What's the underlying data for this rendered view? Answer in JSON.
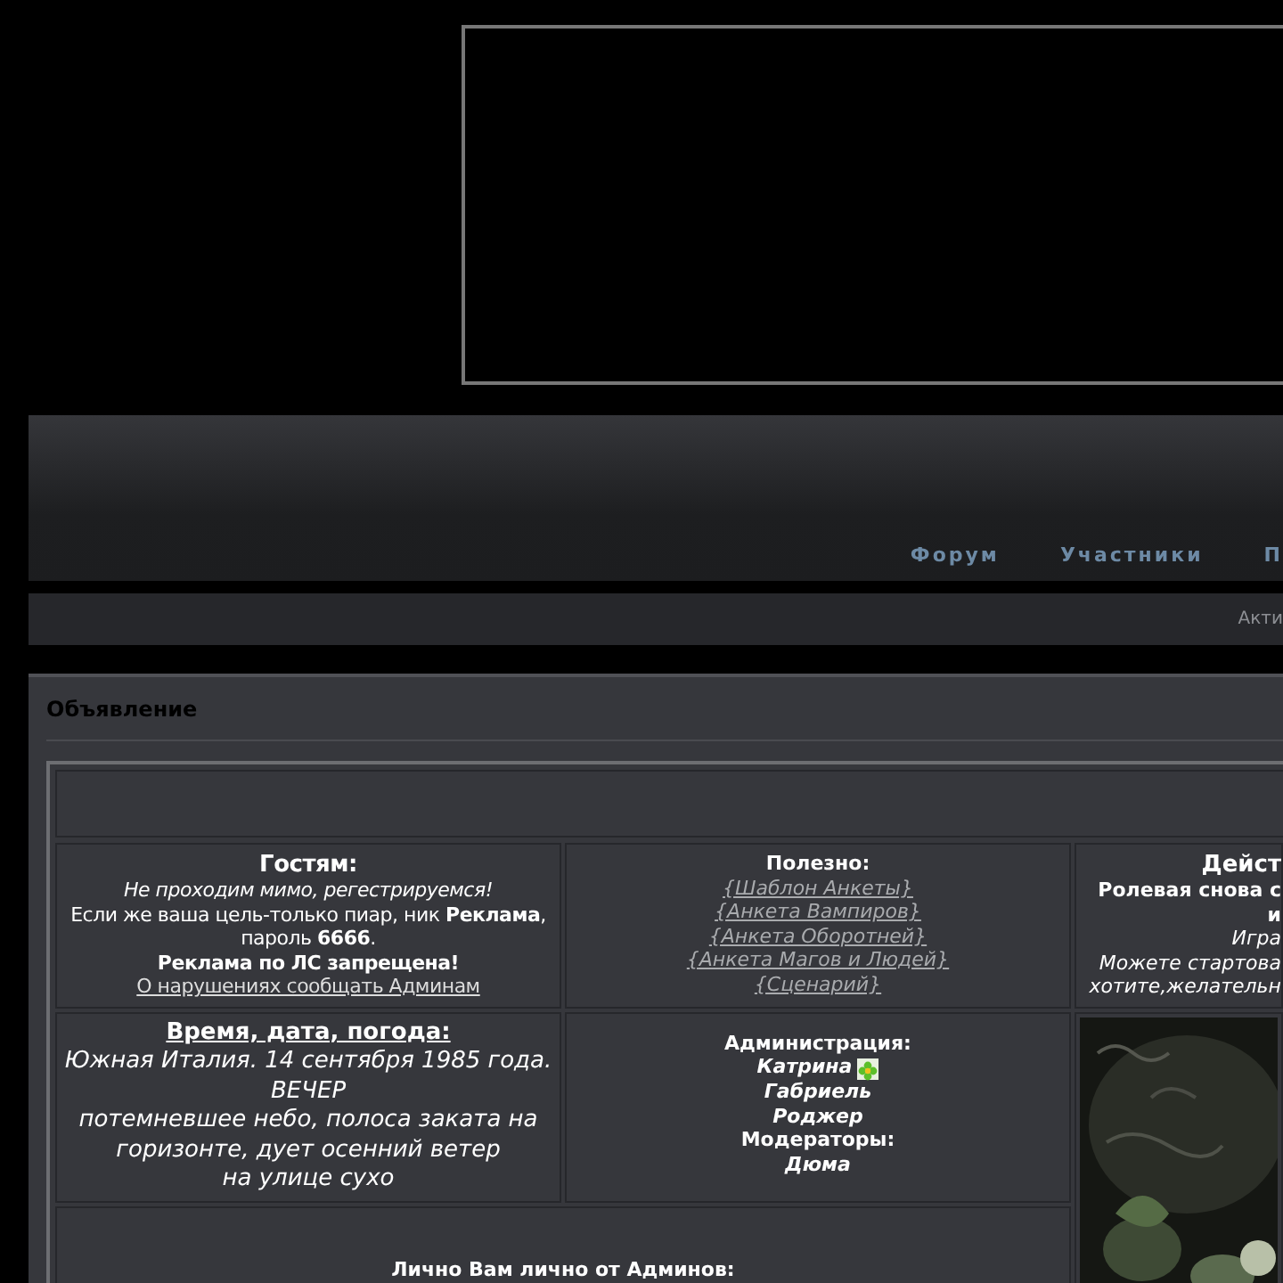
{
  "nav": [
    {
      "label": "Форум"
    },
    {
      "label": "Участники"
    },
    {
      "label": "П"
    }
  ],
  "subbar": {
    "text": "Акти"
  },
  "announcement": {
    "title": "Объявление",
    "guests": {
      "title": "Гостям:",
      "lines": [
        {
          "kind": "italic",
          "text": "Не проходим мимо, регестрируемся!"
        },
        {
          "kind": "plain",
          "text": "Если же ваша цель-только пиар, ник **Реклама**, пароль **6666**."
        },
        {
          "kind": "bold",
          "text": "Реклама по ЛС запрещена!"
        },
        {
          "kind": "link",
          "text": "О нарушениях сообщать Админам"
        }
      ]
    },
    "useful": {
      "title": "Полезно:",
      "links": [
        "{Шаблон Анкеты}",
        "{Анкета Вампиров}",
        "{Анкета Оборотней}",
        "{Анкета Магов и Людей}",
        "{Сценарий}"
      ]
    },
    "action": {
      "title": "Дейст",
      "lines": [
        {
          "kind": "bold",
          "text": "Ролевая снова с"
        },
        {
          "kind": "bold",
          "text": "и"
        },
        {
          "kind": "italic",
          "text": "Игра"
        },
        {
          "kind": "italic",
          "text": "Можете стартова"
        },
        {
          "kind": "italic",
          "text": "хотите,желательн"
        }
      ]
    },
    "time": {
      "title": "Время, дата, погода:",
      "lines": [
        "Южная Италия. 14 сентября 1985 года.",
        "ВЕЧЕР",
        "потемневшее небо, полоса заката на горизонте, дует осенний ветер",
        "на улице сухо"
      ]
    },
    "staff": [
      {
        "kind": "heading",
        "text": "Администрация:"
      },
      {
        "kind": "name",
        "text": "Катрина",
        "online_icon": true
      },
      {
        "kind": "name",
        "text": "Габриель"
      },
      {
        "kind": "name",
        "text": "Роджер"
      },
      {
        "kind": "heading",
        "text": "Модераторы:"
      },
      {
        "kind": "name",
        "text": "Дюма"
      }
    ],
    "personal": {
      "title": "Лично Вам лично от Админов:"
    }
  }
}
